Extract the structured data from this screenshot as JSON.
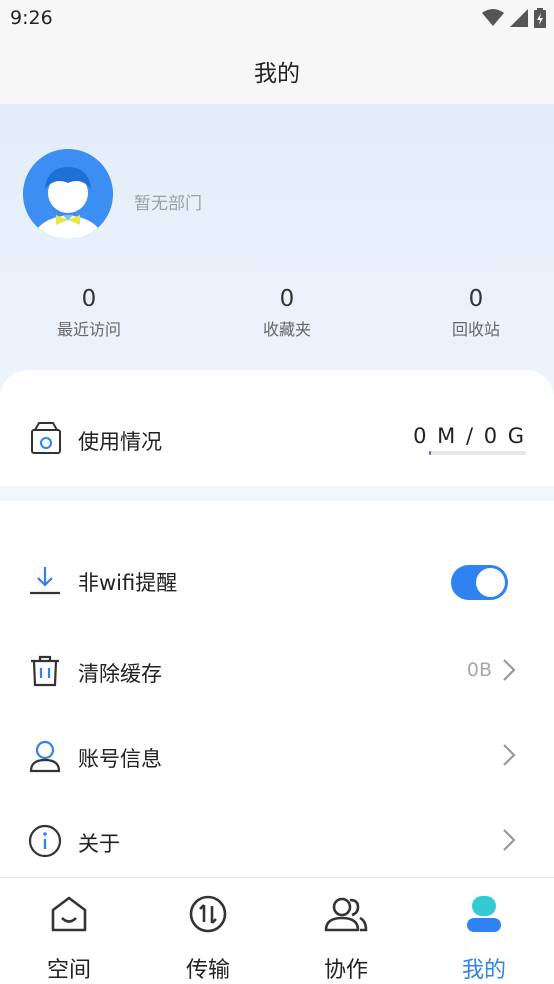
{
  "status_bar": {
    "time": "9:26"
  },
  "header": {
    "title": "我的"
  },
  "profile": {
    "department": "暂无部门"
  },
  "stats": [
    {
      "value": "0",
      "label": "最近访问"
    },
    {
      "value": "0",
      "label": "收藏夹"
    },
    {
      "value": "0",
      "label": "回收站"
    }
  ],
  "usage": {
    "label": "使用情况",
    "value": "0 M / 0 G",
    "fill_fraction": 0.02
  },
  "settings": {
    "wifi_reminder": {
      "label": "非wifi提醒",
      "enabled": true
    },
    "clear_cache": {
      "label": "清除缓存",
      "value": "0B"
    },
    "account_info": {
      "label": "账号信息"
    },
    "about": {
      "label": "关于"
    }
  },
  "tabs": [
    {
      "label": "空间",
      "icon": "home-icon",
      "active": false
    },
    {
      "label": "传输",
      "icon": "transfer-icon",
      "active": false
    },
    {
      "label": "协作",
      "icon": "collaboration-icon",
      "active": false
    },
    {
      "label": "我的",
      "icon": "profile-icon",
      "active": true
    }
  ],
  "colors": {
    "accent": "#2e83f0",
    "avatar_bg": "#3c8ef3",
    "header_bg": "#f7f7f7"
  }
}
